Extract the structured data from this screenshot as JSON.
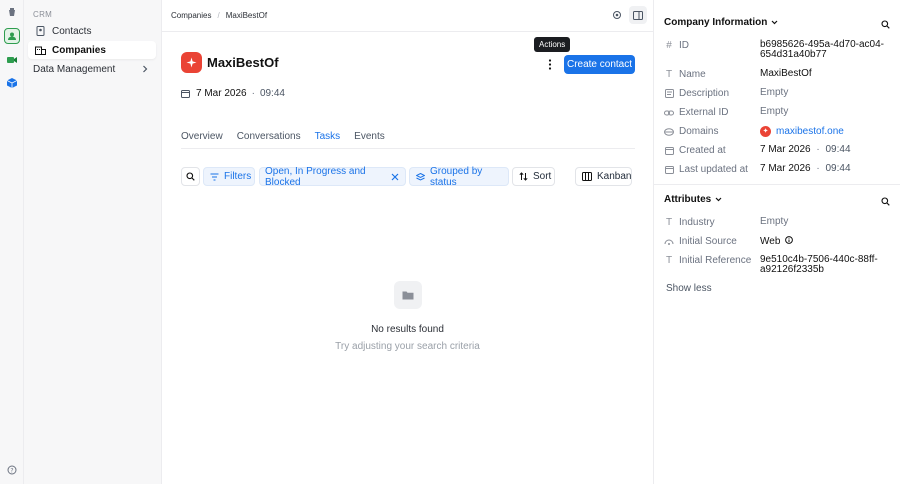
{
  "sidebar": {
    "section": "CRM",
    "items": [
      {
        "label": "Contacts"
      },
      {
        "label": "Companies"
      },
      {
        "label": "Data Management"
      }
    ]
  },
  "breadcrumb": [
    "Companies",
    "MaxiBestOf"
  ],
  "company": {
    "name": "MaxiBestOf",
    "date": "7 Mar 2026",
    "time": "09:44"
  },
  "tooltip": "Actions",
  "actions": {
    "create_contact": "Create contact"
  },
  "tabs": [
    {
      "label": "Overview",
      "active": false
    },
    {
      "label": "Conversations",
      "active": false
    },
    {
      "label": "Tasks",
      "active": true
    },
    {
      "label": "Events",
      "active": false
    }
  ],
  "toolbar": {
    "filters": "Filters",
    "status_filter": "Open, In Progress and Blocked",
    "grouped": "Grouped by status",
    "sort": "Sort",
    "view": "Kanban"
  },
  "empty": {
    "title": "No results found",
    "subtitle": "Try adjusting your search criteria"
  },
  "company_info": {
    "title": "Company Information",
    "fields": [
      {
        "label": "ID",
        "value": "b6985626-495a-4d70-ac04-654d31a40b77"
      },
      {
        "label": "Name",
        "value": "MaxiBestOf"
      },
      {
        "label": "Description",
        "value": "Empty"
      },
      {
        "label": "External ID",
        "value": "Empty"
      },
      {
        "label": "Domains",
        "value": "maxibestof.one"
      },
      {
        "label": "Created at",
        "value": "7 Mar 2026",
        "time": "09:44"
      },
      {
        "label": "Last updated at",
        "value": "7 Mar 2026",
        "time": "09:44"
      }
    ]
  },
  "attributes": {
    "title": "Attributes",
    "fields": [
      {
        "label": "Industry",
        "value": "Empty"
      },
      {
        "label": "Initial Source",
        "value": "Web"
      },
      {
        "label": "Initial Reference",
        "value": "9e510c4b-7506-440c-88ff-a92126f2335b"
      }
    ],
    "show_less": "Show less"
  },
  "colors": {
    "accent": "#1a73e8",
    "brand": "#ea4335",
    "app_green": "#2e9d4f"
  }
}
